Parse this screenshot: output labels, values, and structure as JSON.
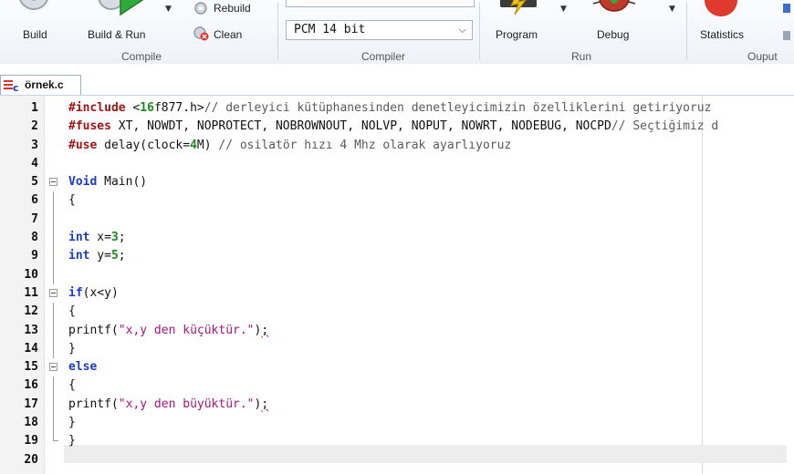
{
  "ribbon": {
    "groups": {
      "compile": {
        "label": "Compile",
        "build_label": "Build",
        "build_run_label": "Build & Run",
        "rebuild_label": "Rebuild",
        "clean_label": "Clean"
      },
      "compiler": {
        "label": "Compiler",
        "selected_value": "PCM 14 bit"
      },
      "run": {
        "label": "Run",
        "program_label": "Program",
        "debug_label": "Debug"
      },
      "output": {
        "label": "Ouput",
        "statistics_label": "Statistics"
      }
    }
  },
  "tab": {
    "label": "örnek.c"
  },
  "editor": {
    "lines": [
      {
        "n": "1",
        "parts": [
          [
            "kw-pp",
            "#include"
          ],
          [
            "",
            ""
          ],
          [
            "plain",
            " <"
          ],
          [
            "num",
            "16"
          ],
          [
            "plain",
            "f877.h>"
          ],
          [
            "cmt",
            "// derleyici kütüphanesinden denetleyicimizin özelliklerini getiriyoruz"
          ]
        ]
      },
      {
        "n": "2",
        "parts": [
          [
            "kw-pp",
            "#fuses"
          ],
          [
            "plain",
            " XT, NOWDT, NOPROTECT, NOBROWNOUT, NOLVP, NOPUT, NOWRT, NODEBUG, NOCPD"
          ],
          [
            "cmt",
            "// Seçtiğimiz d"
          ]
        ]
      },
      {
        "n": "3",
        "parts": [
          [
            "kw-pp",
            "#use"
          ],
          [
            "plain",
            " delay(clock="
          ],
          [
            "num",
            "4"
          ],
          [
            "plain",
            "M) "
          ],
          [
            "cmt",
            "// osilatör hızı 4 Mhz olarak ayarlıyoruz"
          ]
        ]
      },
      {
        "n": "4",
        "parts": []
      },
      {
        "n": "5",
        "parts": [
          [
            "kw",
            "Void"
          ],
          [
            "plain",
            " Main()"
          ]
        ]
      },
      {
        "n": "6",
        "parts": [
          [
            "plain",
            "{"
          ]
        ]
      },
      {
        "n": "7",
        "parts": []
      },
      {
        "n": "8",
        "parts": [
          [
            "kw",
            "int"
          ],
          [
            "plain",
            " x="
          ],
          [
            "num",
            "3"
          ],
          [
            "plain",
            ";"
          ]
        ]
      },
      {
        "n": "9",
        "parts": [
          [
            "kw",
            "int"
          ],
          [
            "plain",
            " y="
          ],
          [
            "num",
            "5"
          ],
          [
            "plain",
            ";"
          ]
        ]
      },
      {
        "n": "10",
        "parts": []
      },
      {
        "n": "11",
        "parts": [
          [
            "kw",
            "if"
          ],
          [
            "plain",
            "(x<y)"
          ]
        ]
      },
      {
        "n": "12",
        "parts": [
          [
            "plain",
            "{"
          ]
        ]
      },
      {
        "n": "13",
        "parts": [
          [
            "plain",
            "printf("
          ],
          [
            "str",
            "\"x,y den küçüktür.\""
          ],
          [
            "plain",
            ")"
          ],
          [
            "squiggle",
            ";"
          ]
        ]
      },
      {
        "n": "14",
        "parts": [
          [
            "plain",
            "}"
          ]
        ]
      },
      {
        "n": "15",
        "parts": [
          [
            "kw",
            "else"
          ]
        ]
      },
      {
        "n": "16",
        "parts": [
          [
            "plain",
            "{"
          ]
        ]
      },
      {
        "n": "17",
        "parts": [
          [
            "plain",
            "printf("
          ],
          [
            "str",
            "\"x,y den büyüktür.\""
          ],
          [
            "plain",
            ")"
          ],
          [
            "squiggle",
            ";"
          ]
        ]
      },
      {
        "n": "18",
        "parts": [
          [
            "plain",
            "}"
          ]
        ]
      },
      {
        "n": "19",
        "parts": [
          [
            "plain",
            "}"
          ]
        ]
      },
      {
        "n": "20",
        "parts": []
      }
    ]
  },
  "colors": {
    "preprocessor": "#a31515",
    "keyword": "#1b3cc7",
    "number": "#1a8a1a",
    "string": "#b01085",
    "comment": "#5a5a5a"
  },
  "icons": [
    "build-icon",
    "build-run-icon",
    "rebuild-icon",
    "clean-icon",
    "program-icon",
    "debug-icon",
    "statistics-icon",
    "c-file-icon",
    "fold-icon"
  ]
}
